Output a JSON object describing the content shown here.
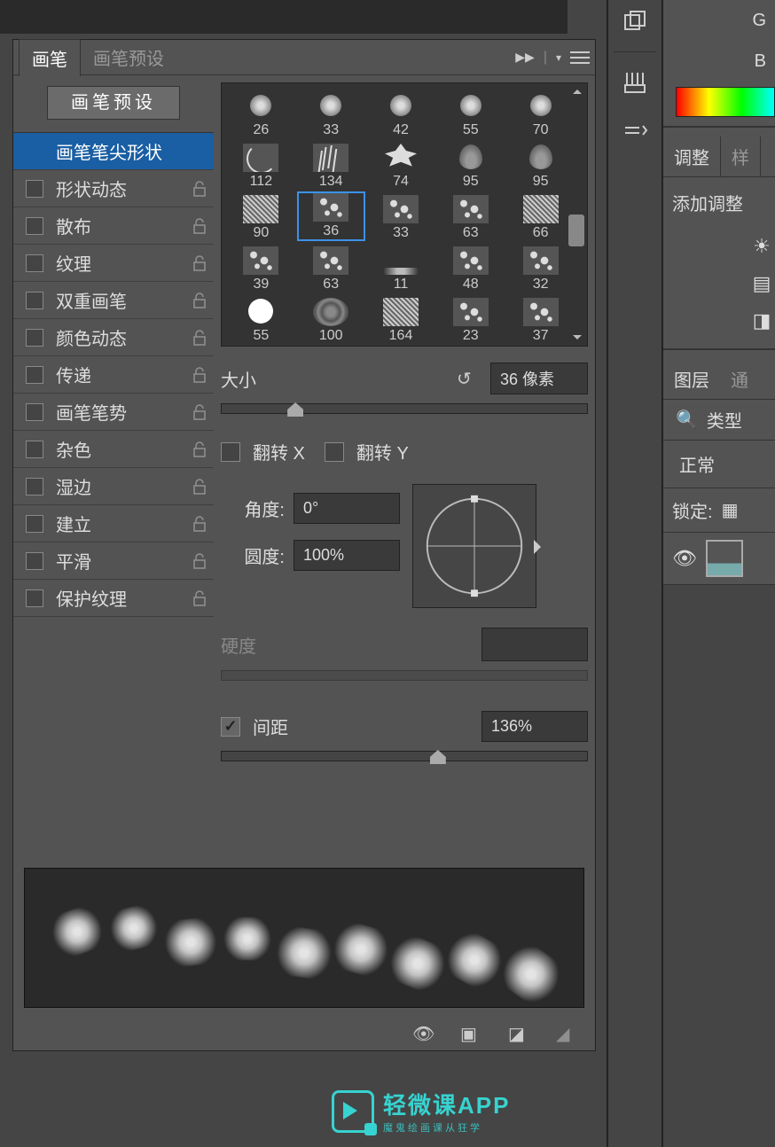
{
  "tabs": {
    "brush": "画笔",
    "presets": "画笔预设"
  },
  "preset_button": "画笔预设",
  "options": [
    {
      "label": "画笔笔尖形状",
      "selected": true,
      "noCheck": true,
      "lock": false
    },
    {
      "label": "形状动态",
      "lock": true
    },
    {
      "label": "散布",
      "lock": true
    },
    {
      "label": "纹理",
      "lock": true
    },
    {
      "label": "双重画笔",
      "lock": true
    },
    {
      "label": "颜色动态",
      "lock": true
    },
    {
      "label": "传递",
      "lock": true
    },
    {
      "label": "画笔笔势",
      "lock": true
    },
    {
      "label": "杂色",
      "lock": true
    },
    {
      "label": "湿边",
      "lock": true
    },
    {
      "label": "建立",
      "lock": true
    },
    {
      "label": "平滑",
      "lock": true
    },
    {
      "label": "保护纹理",
      "lock": true
    }
  ],
  "brushes": [
    {
      "size": "26",
      "t": "t-round"
    },
    {
      "size": "33",
      "t": "t-round"
    },
    {
      "size": "42",
      "t": "t-round"
    },
    {
      "size": "55",
      "t": "t-round"
    },
    {
      "size": "70",
      "t": "t-round"
    },
    {
      "size": "112",
      "t": "t-curve"
    },
    {
      "size": "134",
      "t": "t-grass"
    },
    {
      "size": "74",
      "t": "t-leaf"
    },
    {
      "size": "95",
      "t": "t-drop"
    },
    {
      "size": "95",
      "t": "t-drop"
    },
    {
      "size": "90",
      "t": "t-chalk"
    },
    {
      "size": "36",
      "t": "t-splat",
      "sel": true
    },
    {
      "size": "33",
      "t": "t-splat"
    },
    {
      "size": "63",
      "t": "t-splat"
    },
    {
      "size": "66",
      "t": "t-chalk"
    },
    {
      "size": "39",
      "t": "t-splat"
    },
    {
      "size": "63",
      "t": "t-splat"
    },
    {
      "size": "11",
      "t": "t-smear"
    },
    {
      "size": "48",
      "t": "t-splat"
    },
    {
      "size": "32",
      "t": "t-splat"
    },
    {
      "size": "55",
      "t": "t-circle"
    },
    {
      "size": "100",
      "t": "t-rough"
    },
    {
      "size": "164",
      "t": "t-chalk"
    },
    {
      "size": "23",
      "t": "t-splat"
    },
    {
      "size": "37",
      "t": "t-splat"
    }
  ],
  "size": {
    "label": "大小",
    "value": "36 像素",
    "pos": 18
  },
  "flip": {
    "x": "翻转 X",
    "y": "翻转 Y"
  },
  "angle": {
    "label": "角度:",
    "value": "0°"
  },
  "roundness": {
    "label": "圆度:",
    "value": "100%"
  },
  "hardness": {
    "label": "硬度"
  },
  "spacing": {
    "label": "间距",
    "value": "136%",
    "pos": 57
  },
  "right": {
    "g": "G",
    "b": "B",
    "adjust_tab": "调整",
    "style_tab": "样",
    "add_adjust": "添加调整",
    "layers_tab": "图层",
    "channels_tab": "通",
    "search": "类型",
    "blend": "正常",
    "lock": "锁定:"
  },
  "watermark": {
    "big": "轻微课APP",
    "small": "魔鬼绘画课从狂学"
  }
}
